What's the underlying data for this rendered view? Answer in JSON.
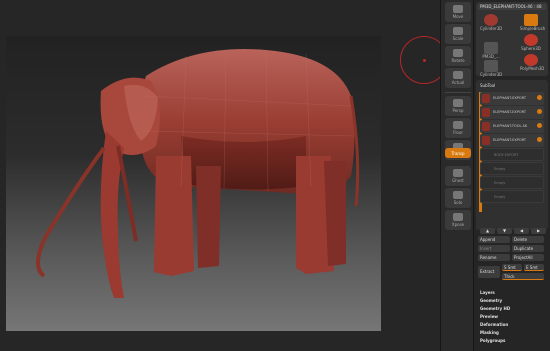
{
  "tool": {
    "title": "PM3D_ELEPHANT-TOOL-46 : 48",
    "thumbs": [
      "Cylinder3D",
      "SimpleBrush",
      "Sphere3D",
      "PM3D_...",
      "PolyMesh3D",
      "Cylinder3D"
    ]
  },
  "shelf": {
    "buttons": [
      "Move",
      "Scale",
      "Rotate",
      "Actual",
      "AAHalf",
      "Persp",
      "Floor",
      "Local",
      "Frame",
      "Move",
      "Scale",
      "Rotate",
      "Transp",
      "Ghost",
      "Solo",
      "Xpose"
    ],
    "active_index": 12
  },
  "subtool": {
    "header": "SubTool",
    "slots": [
      {
        "label": "ELEPHANT-EXPORT",
        "filled": true
      },
      {
        "label": "ELEPHANT-EXPORT",
        "filled": true
      },
      {
        "label": "ELEPHANT-TOOL-SK",
        "filled": true
      },
      {
        "label": "ELEPHANT-EXPORT",
        "filled": true
      },
      {
        "label": "BODY-EXPORT",
        "filled": false
      },
      {
        "label": "Empty",
        "filled": false
      },
      {
        "label": "Empty",
        "filled": false
      },
      {
        "label": "Empty",
        "filled": false
      }
    ]
  },
  "actions": {
    "append": "Append",
    "delete": "Delete",
    "insert": "Insert",
    "duplicate": "Duplicate",
    "rename": "Rename",
    "project_all": "ProjectAll",
    "extract": "Extract",
    "s_smt": "S Smt",
    "e_smt": "E Smt",
    "thick": "Thick"
  },
  "menus": [
    "Layers",
    "Geometry",
    "Geometry HD",
    "Preview",
    "Deformation",
    "Masking",
    "Polygroups"
  ],
  "colors": {
    "accent": "#d97a10",
    "model": "#a03a30",
    "brush_ring": "#b62626"
  }
}
